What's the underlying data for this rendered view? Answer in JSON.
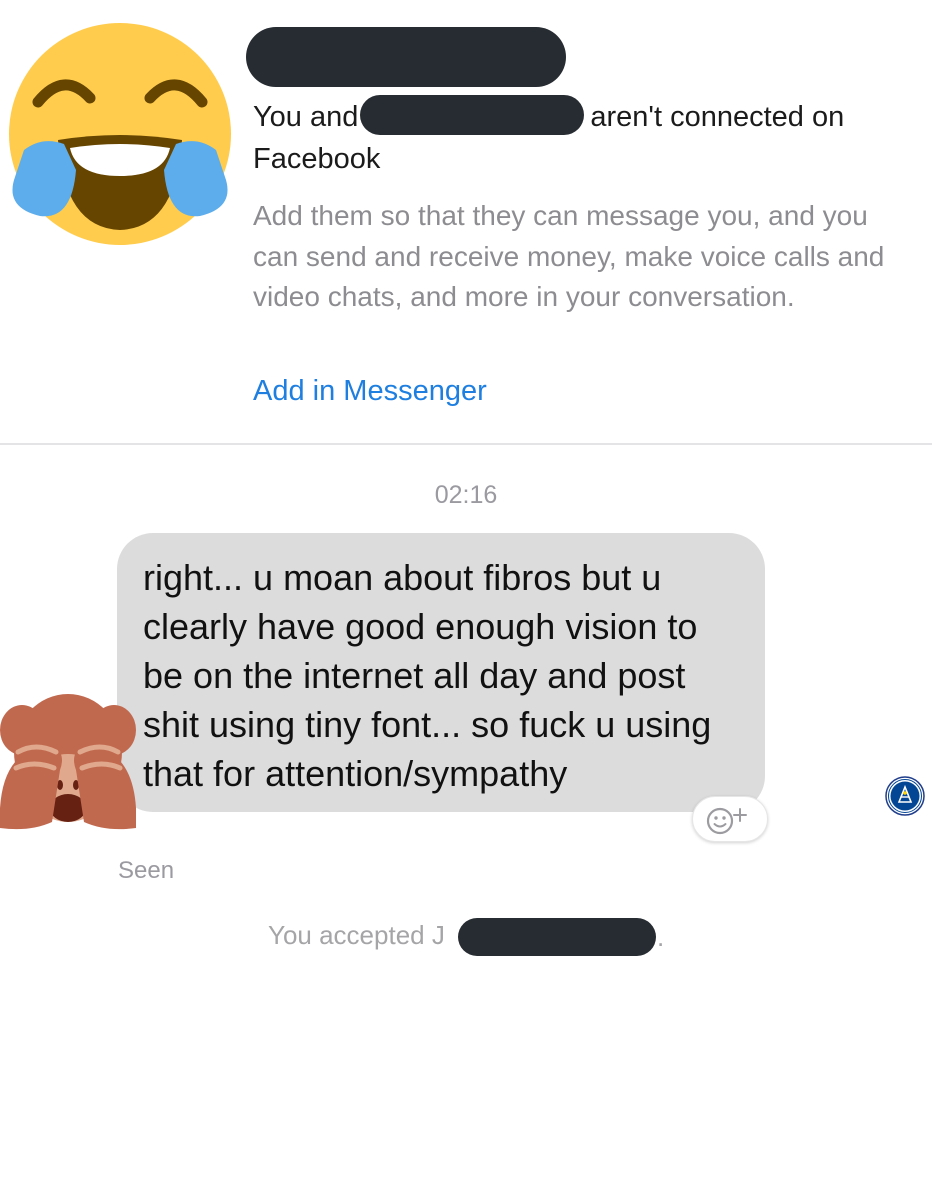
{
  "header": {
    "notice_prefix": "You and",
    "notice_suffix": "aren't connected on Facebook",
    "description": "Add them so that they can message you, and you can send and receive money, make voice calls and video chats, and more in your conversation.",
    "add_link": "Add in Messenger",
    "avatar_icon": "face-with-tears-of-joy-icon"
  },
  "conversation": {
    "timestamp": "02:16",
    "message": {
      "text": "right... u moan about fibros but u clearly have good enough vision to be on the internet all day and post shit using tiny font... so fuck u using that for attention/sympathy",
      "sender_avatar_icon": "see-no-evil-monkey-icon"
    },
    "react_icon": "add-reaction-icon",
    "seen_avatar_icon": "club-crest-icon",
    "seen_label": "Seen",
    "accepted_text": "You accepted J",
    "accepted_trailing": "."
  },
  "colors": {
    "link_blue": "#1e7fe0",
    "bubble_gray": "#dcdcdc",
    "redaction": "#262c31",
    "secondary_text": "#8d8d91"
  }
}
